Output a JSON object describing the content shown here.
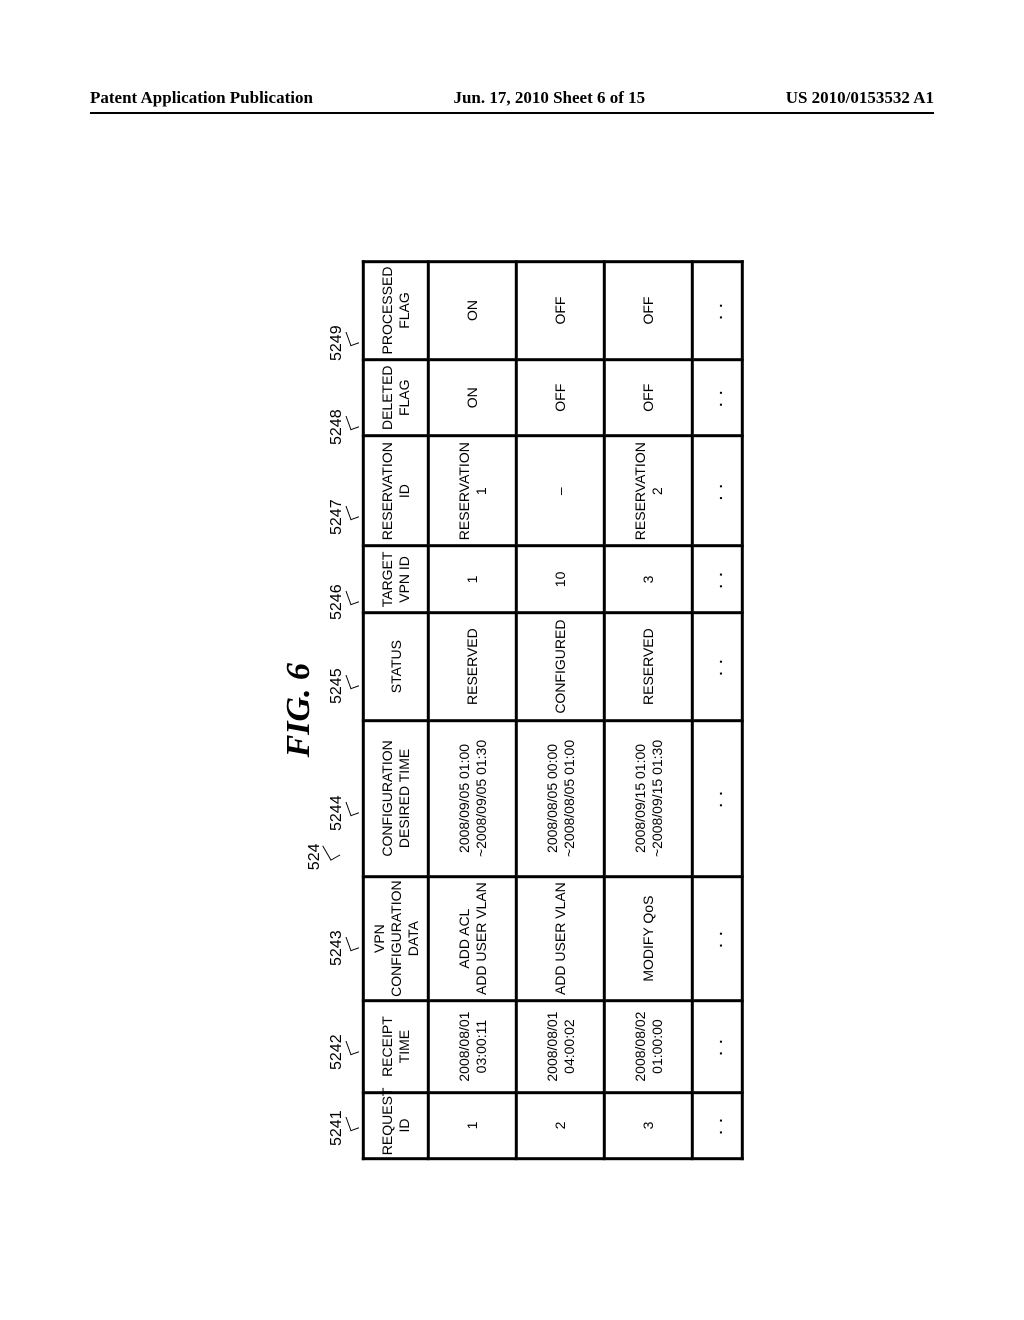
{
  "header": {
    "left": "Patent Application Publication",
    "center": "Jun. 17, 2010  Sheet 6 of 15",
    "right": "US 2010/0153532 A1"
  },
  "figure_label": "FIG. 6",
  "column_labels": {
    "table_ref": "524",
    "c1": "5241",
    "c2": "5242",
    "c3": "5243",
    "c4": "5244",
    "c5": "5245",
    "c6": "5246",
    "c7": "5247",
    "c8": "5248",
    "c9": "5249"
  },
  "columns": {
    "request_id": "REQUEST\nID",
    "receipt_time": "RECEIPT\nTIME",
    "vpn_config": "VPN\nCONFIGURATION\nDATA",
    "config_time": "CONFIGURATION\nDESIRED TIME",
    "status": "STATUS",
    "target_vpn": "TARGET\nVPN ID",
    "reservation_id": "RESERVATION\nID",
    "deleted_flag": "DELETED\nFLAG",
    "processed_flag": "PROCESSED\nFLAG"
  },
  "rows": [
    {
      "request_id": "1",
      "receipt_time": "2008/08/01\n03:00:11",
      "vpn_config": "ADD ACL\nADD USER VLAN",
      "config_time": "2008/09/05 01:00\n~2008/09/05 01:30",
      "status": "RESERVED",
      "target_vpn": "1",
      "reservation_id": "RESERVATION\n1",
      "deleted_flag": "ON",
      "processed_flag": "ON"
    },
    {
      "request_id": "2",
      "receipt_time": "2008/08/01\n04:00:02",
      "vpn_config": "ADD USER VLAN",
      "config_time": "2008/08/05 00:00\n~2008/08/05 01:00",
      "status": "CONFIGURED",
      "target_vpn": "10",
      "reservation_id": "–",
      "deleted_flag": "OFF",
      "processed_flag": "OFF"
    },
    {
      "request_id": "3",
      "receipt_time": "2008/08/02\n01:00:00",
      "vpn_config": "MODIFY QoS",
      "config_time": "2008/09/15 01:00\n~2008/09/15 01:30",
      "status": "RESERVED",
      "target_vpn": "3",
      "reservation_id": "RESERVATION\n2",
      "deleted_flag": "OFF",
      "processed_flag": "OFF"
    }
  ],
  "ellipsis": ". ."
}
